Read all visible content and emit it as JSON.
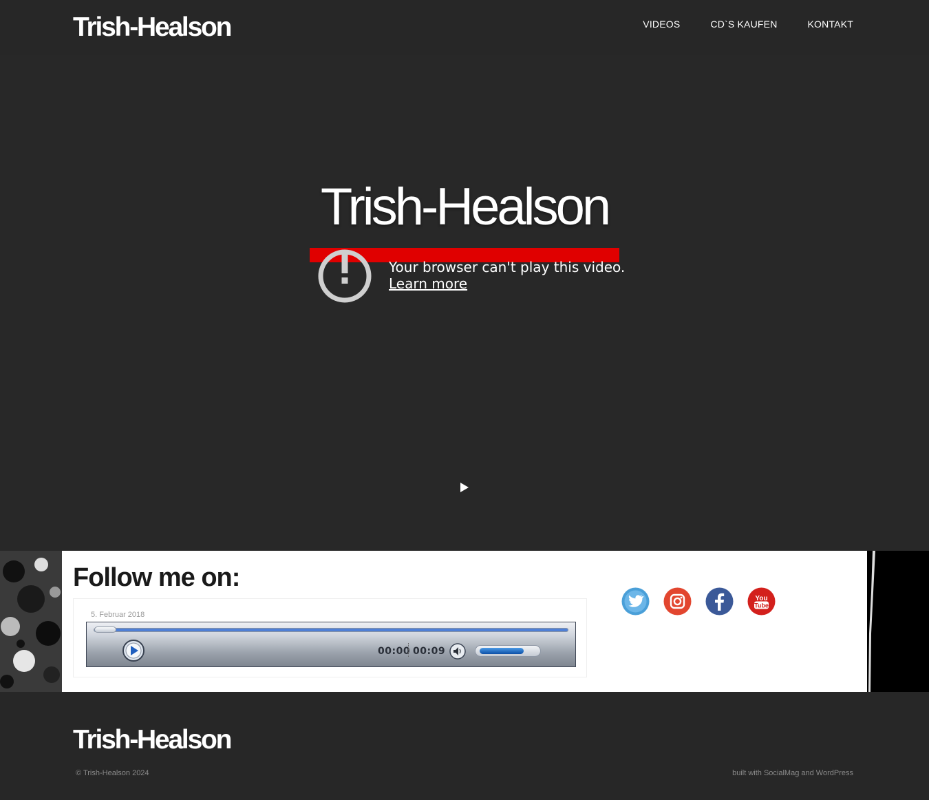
{
  "header": {
    "logo": "Trish-Healson",
    "nav": [
      "VIDEOS",
      "CD`S KAUFEN",
      "KONTAKT"
    ]
  },
  "hero": {
    "title": "Trish-Healson",
    "error_message": "Your browser can't play this video.",
    "learn_more": "Learn more",
    "icons": {
      "warning": "exclamation-circle-icon",
      "play": "play-icon"
    },
    "accent_color": "#e00000"
  },
  "follow": {
    "title": "Follow me on:",
    "audio": {
      "date": "5. Februar 2018",
      "current_time": "00:00",
      "duration": "00:09",
      "progress": 0,
      "volume": 0.7
    },
    "socials": [
      {
        "name": "Twitter",
        "icon": "twitter-icon",
        "color": "#4a9fd8"
      },
      {
        "name": "Instagram",
        "icon": "instagram-icon",
        "color": "#e2462f"
      },
      {
        "name": "Facebook",
        "icon": "facebook-icon",
        "color": "#3b5998"
      },
      {
        "name": "YouTube",
        "icon": "youtube-icon",
        "color": "#d3201c"
      }
    ]
  },
  "footer": {
    "logo": "Trish-Healson",
    "copyright": "© Trish-Healson 2024",
    "built_with": "built with SocialMag and WordPress"
  }
}
